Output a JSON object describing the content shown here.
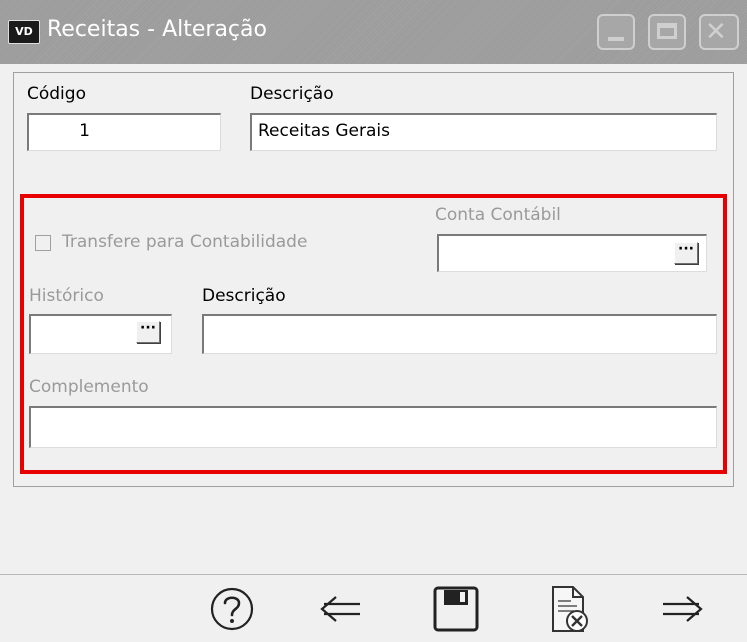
{
  "window": {
    "icon_text": "VD",
    "title": "Receitas - Alteração"
  },
  "form": {
    "codigo_label": "Código",
    "codigo_value": "1",
    "descricao_label": "Descrição",
    "descricao_value": "Receitas Gerais",
    "transfere_label": "Transfere para Contabilidade",
    "transfere_checked": false,
    "conta_contabil_label": "Conta Contábil",
    "conta_contabil_value": "",
    "historico_label": "Histórico",
    "historico_value": "",
    "historico_descricao_label": "Descrição",
    "historico_descricao_value": "",
    "complemento_label": "Complemento",
    "complemento_value": "",
    "lookup_button_label": "···"
  },
  "toolbar": {
    "buttons": [
      "help-icon",
      "arrow-left-icon",
      "save-icon",
      "cancel-document-icon",
      "arrow-right-icon"
    ]
  },
  "colors": {
    "highlight": "#e80000",
    "titlebar": "#9f9f9f"
  }
}
